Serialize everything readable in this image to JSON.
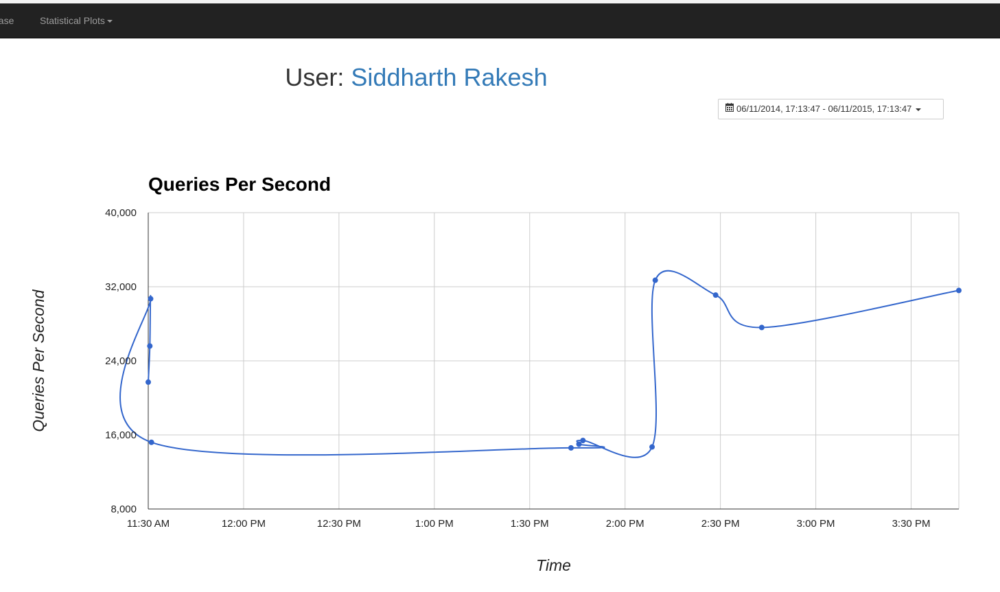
{
  "navbar": {
    "items": [
      {
        "label": "base"
      },
      {
        "label": "Statistical Plots"
      }
    ]
  },
  "header": {
    "user_prefix": "User: ",
    "user_name": "Siddharth Rakesh"
  },
  "date_range": {
    "label": "06/11/2014, 17:13:47 - 06/11/2015, 17:13:47"
  },
  "colors": {
    "navbar_bg": "#222222",
    "accent": "#337ab7",
    "series": "#3366cc"
  },
  "chart_data": {
    "type": "line",
    "title": "Queries Per Second",
    "xlabel": "Time",
    "ylabel": "Queries Per Second",
    "ylim": [
      8000,
      40000
    ],
    "yticks": [
      8000,
      16000,
      24000,
      32000,
      40000
    ],
    "ytick_labels": [
      "8,000",
      "16,000",
      "24,000",
      "32,000",
      "40,000"
    ],
    "xlim": [
      "11:30",
      "15:45"
    ],
    "xticks": [
      "11:30",
      "12:00",
      "12:30",
      "13:00",
      "13:30",
      "14:00",
      "14:30",
      "15:00",
      "15:30"
    ],
    "xtick_labels": [
      "11:30 AM",
      "12:00 PM",
      "12:30 PM",
      "1:00 PM",
      "1:30 PM",
      "2:00 PM",
      "2:30 PM",
      "3:00 PM",
      "3:30 PM"
    ],
    "grid": true,
    "smooth": true,
    "series": [
      {
        "x": [
          "11:30:00",
          "11:30:30",
          "11:30:45",
          "11:31:00",
          "13:43:00",
          "13:45:30",
          "13:46:45",
          "14:08:30",
          "14:09:30",
          "14:28:30",
          "14:43:00",
          "15:45:00"
        ],
        "y": [
          21700,
          25600,
          30700,
          15200,
          14600,
          15000,
          15400,
          14700,
          32700,
          31100,
          27600,
          31600
        ]
      }
    ]
  }
}
